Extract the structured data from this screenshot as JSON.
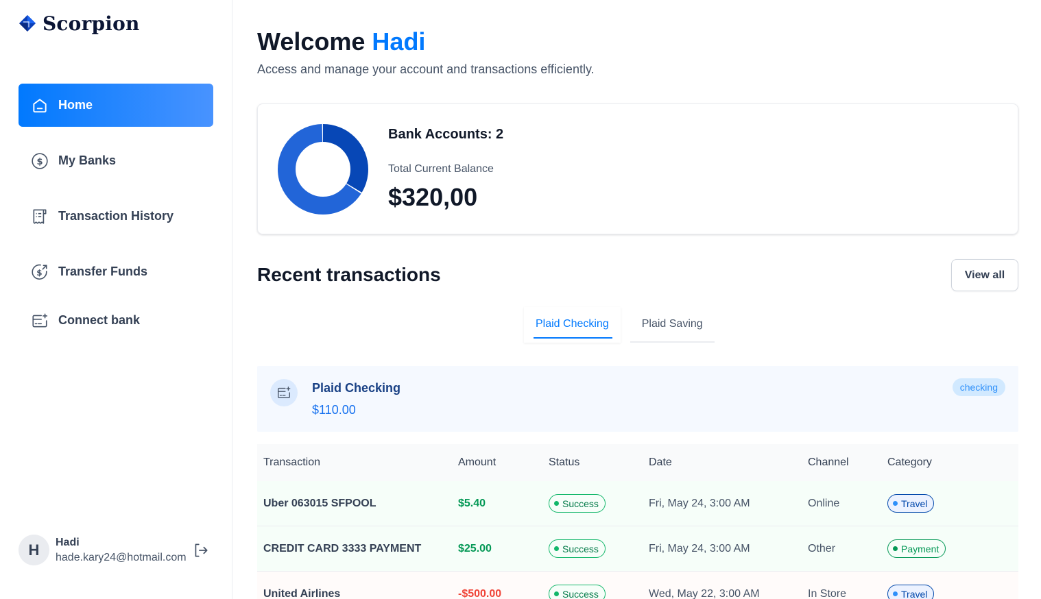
{
  "brand": {
    "name": "Scorpion"
  },
  "sidebar": {
    "items": [
      {
        "label": "Home",
        "icon": "home-icon",
        "active": true
      },
      {
        "label": "My Banks",
        "icon": "dollar-circle-icon",
        "active": false
      },
      {
        "label": "Transaction History",
        "icon": "receipt-icon",
        "active": false
      },
      {
        "label": "Transfer Funds",
        "icon": "money-send-icon",
        "active": false
      },
      {
        "label": "Connect bank",
        "icon": "card-add-icon",
        "active": false
      }
    ]
  },
  "user": {
    "initial": "H",
    "name": "Hadi",
    "email": "hade.kary24@hotmail.com",
    "logout_icon": "logout-icon"
  },
  "header": {
    "welcome": "Welcome",
    "user_name": "Hadi",
    "subtitle": "Access and manage your account and transactions efficiently."
  },
  "balance": {
    "bank_accounts": "Bank Accounts: 2",
    "label": "Total Current Balance",
    "value": "$320,00",
    "chart_segments": [
      {
        "fraction": 0.34,
        "color": "#0747b6"
      },
      {
        "fraction": 0.66,
        "color": "#2265d8"
      }
    ]
  },
  "recent": {
    "title": "Recent transactions",
    "view_all": "View all",
    "tabs": [
      {
        "label": "Plaid Checking",
        "active": true
      },
      {
        "label": "Plaid Saving",
        "active": false
      }
    ],
    "account": {
      "name": "Plaid Checking",
      "balance": "$110.00",
      "type": "checking",
      "icon": "card-add-icon"
    }
  },
  "table": {
    "headers": [
      "Transaction",
      "Amount",
      "Status",
      "Date",
      "Channel",
      "Category"
    ],
    "rows": [
      {
        "name": "Uber 063015 SFPOOL",
        "amount": "$5.40",
        "status": "Success",
        "date": "Fri, May 24, 3:00 AM",
        "channel": "Online",
        "category": "Travel"
      },
      {
        "name": "CREDIT CARD 3333 PAYMENT",
        "amount": "$25.00",
        "status": "Success",
        "date": "Fri, May 24, 3:00 AM",
        "channel": "Other",
        "category": "Payment"
      },
      {
        "name": "United Airlines",
        "amount": "-$500.00",
        "status": "Success",
        "date": "Wed, May 22, 3:00 AM",
        "channel": "In Store",
        "category": "Travel"
      }
    ]
  },
  "colors": {
    "accent": "#0179fe",
    "success": "#12b76a",
    "danger": "#f04438"
  }
}
